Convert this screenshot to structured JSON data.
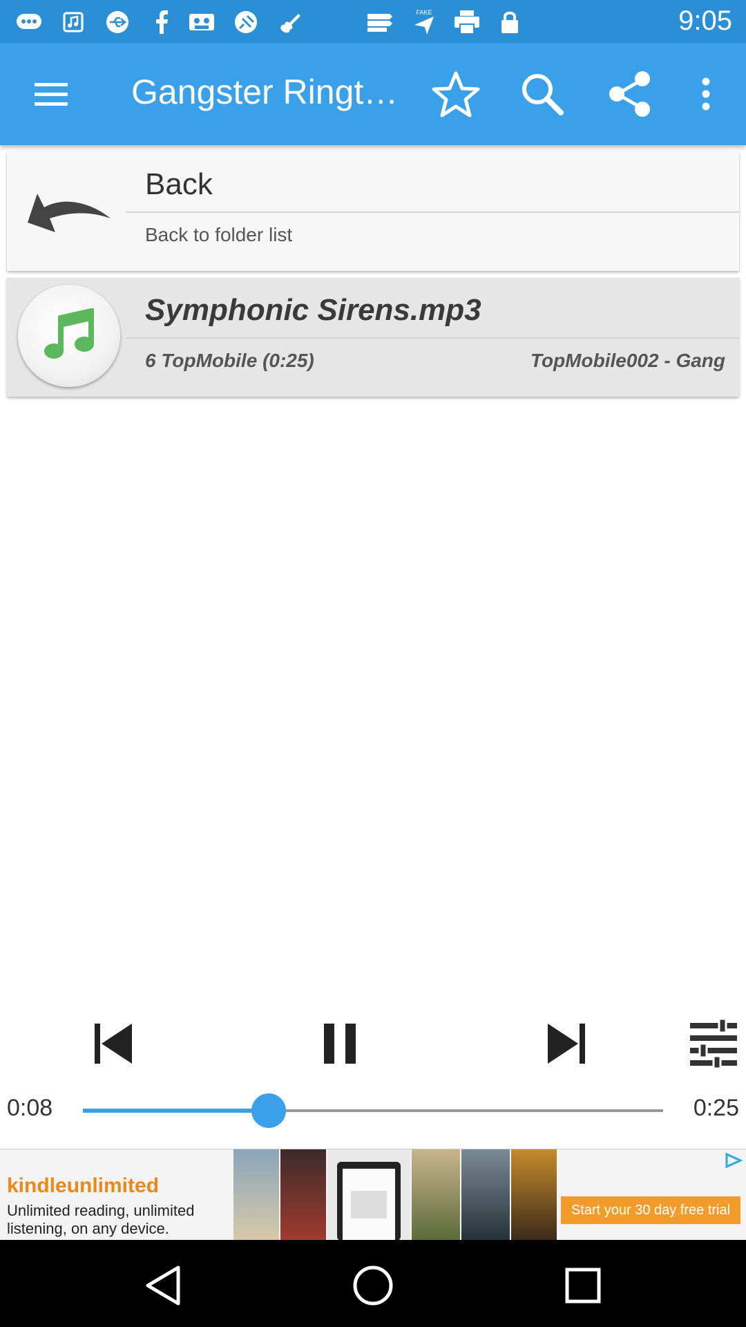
{
  "status_bar": {
    "time": "9:05",
    "icons": [
      "messaging-icon",
      "music-icon",
      "usb-icon",
      "facebook-icon",
      "cassette-icon",
      "satellite-icon",
      "violin-icon",
      "news-icon",
      "fake-gps-icon",
      "print-icon",
      "lock-icon"
    ]
  },
  "app_bar": {
    "title": "Gangster Ringt…",
    "actions": [
      "menu-icon",
      "star-icon",
      "search-icon",
      "share-icon",
      "more-vert-icon"
    ]
  },
  "list": {
    "back": {
      "title": "Back",
      "subtitle": "Back to folder list"
    },
    "track": {
      "title": "Symphonic Sirens.mp3",
      "subtitle_left": "6 TopMobile (0:25)",
      "subtitle_right": "TopMobile002 - Gang"
    }
  },
  "player": {
    "elapsed": "0:08",
    "duration": "0:25",
    "progress": 0.32
  },
  "ad": {
    "brand": "kindleunlimited",
    "text": "Unlimited reading, unlimited listening, on any device.",
    "cta": "Start your 30 day free trial"
  },
  "colors": {
    "primary": "#3aa0ea",
    "status_bar": "#2a8fd4",
    "music_note": "#5cb85c"
  }
}
